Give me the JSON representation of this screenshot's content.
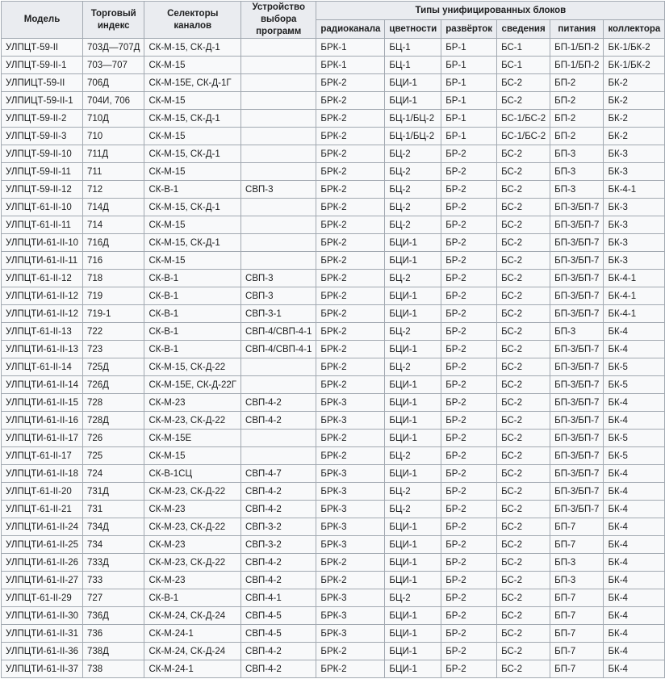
{
  "header": {
    "model": "Модель",
    "index": "Торговый индекс",
    "selectors": "Селекторы каналов",
    "program_device": "Устройство выбора программ",
    "blocks_group": "Типы унифицированных блоков",
    "blocks": [
      "радиоканала",
      "цветности",
      "развёрток",
      "сведения",
      "питания",
      "коллектора"
    ]
  },
  "rows": [
    [
      "УЛПЦТ-59-II",
      "703Д—707Д",
      "СК-М-15, СК-Д-1",
      "",
      "БРК-1",
      "БЦ-1",
      "БР-1",
      "БС-1",
      "БП-1/БП-2",
      "БК-1/БК-2"
    ],
    [
      "УЛПЦТ-59-II-1",
      "703—707",
      "СК-М-15",
      "",
      "БРК-1",
      "БЦ-1",
      "БР-1",
      "БС-1",
      "БП-1/БП-2",
      "БК-1/БК-2"
    ],
    [
      "УЛПИЦТ-59-II",
      "706Д",
      "СК-М-15Е, СК-Д-1Г",
      "",
      "БРК-2",
      "БЦИ-1",
      "БР-1",
      "БС-2",
      "БП-2",
      "БК-2"
    ],
    [
      "УЛПИЦТ-59-II-1",
      "704И, 706",
      "СК-М-15",
      "",
      "БРК-2",
      "БЦИ-1",
      "БР-1",
      "БС-2",
      "БП-2",
      "БК-2"
    ],
    [
      "УЛПЦТ-59-II-2",
      "710Д",
      "СК-М-15, СК-Д-1",
      "",
      "БРК-2",
      "БЦ-1/БЦ-2",
      "БР-1",
      "БС-1/БС-2",
      "БП-2",
      "БК-2"
    ],
    [
      "УЛПЦТ-59-II-3",
      "710",
      "СК-М-15",
      "",
      "БРК-2",
      "БЦ-1/БЦ-2",
      "БР-1",
      "БС-1/БС-2",
      "БП-2",
      "БК-2"
    ],
    [
      "УЛПЦТ-59-II-10",
      "711Д",
      "СК-М-15, СК-Д-1",
      "",
      "БРК-2",
      "БЦ-2",
      "БР-2",
      "БС-2",
      "БП-3",
      "БК-3"
    ],
    [
      "УЛПЦТ-59-II-11",
      "711",
      "СК-М-15",
      "",
      "БРК-2",
      "БЦ-2",
      "БР-2",
      "БС-2",
      "БП-3",
      "БК-3"
    ],
    [
      "УЛПЦТ-59-II-12",
      "712",
      "СК-В-1",
      "СВП-3",
      "БРК-2",
      "БЦ-2",
      "БР-2",
      "БС-2",
      "БП-3",
      "БК-4-1"
    ],
    [
      "УЛПЦТ-61-II-10",
      "714Д",
      "СК-М-15, СК-Д-1",
      "",
      "БРК-2",
      "БЦ-2",
      "БР-2",
      "БС-2",
      "БП-3/БП-7",
      "БК-3"
    ],
    [
      "УЛПЦТ-61-II-11",
      "714",
      "СК-М-15",
      "",
      "БРК-2",
      "БЦ-2",
      "БР-2",
      "БС-2",
      "БП-3/БП-7",
      "БК-3"
    ],
    [
      "УЛПЦТИ-61-II-10",
      "716Д",
      "СК-М-15, СК-Д-1",
      "",
      "БРК-2",
      "БЦИ-1",
      "БР-2",
      "БС-2",
      "БП-3/БП-7",
      "БК-3"
    ],
    [
      "УЛПЦТИ-61-II-11",
      "716",
      "СК-М-15",
      "",
      "БРК-2",
      "БЦИ-1",
      "БР-2",
      "БС-2",
      "БП-3/БП-7",
      "БК-3"
    ],
    [
      "УЛПЦТ-61-II-12",
      "718",
      "СК-В-1",
      "СВП-3",
      "БРК-2",
      "БЦ-2",
      "БР-2",
      "БС-2",
      "БП-3/БП-7",
      "БК-4-1"
    ],
    [
      "УЛПЦТИ-61-II-12",
      "719",
      "СК-В-1",
      "СВП-3",
      "БРК-2",
      "БЦИ-1",
      "БР-2",
      "БС-2",
      "БП-3/БП-7",
      "БК-4-1"
    ],
    [
      "УЛПЦТИ-61-II-12",
      "719-1",
      "СК-В-1",
      "СВП-3-1",
      "БРК-2",
      "БЦИ-1",
      "БР-2",
      "БС-2",
      "БП-3/БП-7",
      "БК-4-1"
    ],
    [
      "УЛПЦТ-61-II-13",
      "722",
      "СК-В-1",
      "СВП-4/СВП-4-1",
      "БРК-2",
      "БЦ-2",
      "БР-2",
      "БС-2",
      "БП-3",
      "БК-4"
    ],
    [
      "УЛПЦТИ-61-II-13",
      "723",
      "СК-В-1",
      "СВП-4/СВП-4-1",
      "БРК-2",
      "БЦИ-1",
      "БР-2",
      "БС-2",
      "БП-3/БП-7",
      "БК-4"
    ],
    [
      "УЛПЦТ-61-II-14",
      "725Д",
      "СК-М-15, СК-Д-22",
      "",
      "БРК-2",
      "БЦ-2",
      "БР-2",
      "БС-2",
      "БП-3/БП-7",
      "БК-5"
    ],
    [
      "УЛПЦТИ-61-II-14",
      "726Д",
      "СК-М-15Е, СК-Д-22Г",
      "",
      "БРК-2",
      "БЦИ-1",
      "БР-2",
      "БС-2",
      "БП-3/БП-7",
      "БК-5"
    ],
    [
      "УЛПЦТИ-61-II-15",
      "728",
      "СК-М-23",
      "СВП-4-2",
      "БРК-3",
      "БЦИ-1",
      "БР-2",
      "БС-2",
      "БП-3/БП-7",
      "БК-4"
    ],
    [
      "УЛПЦТИ-61-II-16",
      "728Д",
      "СК-М-23, СК-Д-22",
      "СВП-4-2",
      "БРК-3",
      "БЦИ-1",
      "БР-2",
      "БС-2",
      "БП-3/БП-7",
      "БК-4"
    ],
    [
      "УЛПЦТИ-61-II-17",
      "726",
      "СК-М-15Е",
      "",
      "БРК-2",
      "БЦИ-1",
      "БР-2",
      "БС-2",
      "БП-3/БП-7",
      "БК-5"
    ],
    [
      "УЛПЦТ-61-II-17",
      "725",
      "СК-М-15",
      "",
      "БРК-2",
      "БЦ-2",
      "БР-2",
      "БС-2",
      "БП-3/БП-7",
      "БК-5"
    ],
    [
      "УЛПЦТИ-61-II-18",
      "724",
      "СК-В-1СЦ",
      "СВП-4-7",
      "БРК-3",
      "БЦИ-1",
      "БР-2",
      "БС-2",
      "БП-3/БП-7",
      "БК-4"
    ],
    [
      "УЛПЦТ-61-II-20",
      "731Д",
      "СК-М-23, СК-Д-22",
      "СВП-4-2",
      "БРК-3",
      "БЦ-2",
      "БР-2",
      "БС-2",
      "БП-3/БП-7",
      "БК-4"
    ],
    [
      "УЛПЦТ-61-II-21",
      "731",
      "СК-М-23",
      "СВП-4-2",
      "БРК-3",
      "БЦ-2",
      "БР-2",
      "БС-2",
      "БП-3/БП-7",
      "БК-4"
    ],
    [
      "УЛПЦТИ-61-II-24",
      "734Д",
      "СК-М-23, СК-Д-22",
      "СВП-3-2",
      "БРК-3",
      "БЦИ-1",
      "БР-2",
      "БС-2",
      "БП-7",
      "БК-4"
    ],
    [
      "УЛПЦТИ-61-II-25",
      "734",
      "СК-М-23",
      "СВП-3-2",
      "БРК-3",
      "БЦИ-1",
      "БР-2",
      "БС-2",
      "БП-7",
      "БК-4"
    ],
    [
      "УЛПЦТИ-61-II-26",
      "733Д",
      "СК-М-23, СК-Д-22",
      "СВП-4-2",
      "БРК-2",
      "БЦИ-1",
      "БР-2",
      "БС-2",
      "БП-3",
      "БК-4"
    ],
    [
      "УЛПЦТИ-61-II-27",
      "733",
      "СК-М-23",
      "СВП-4-2",
      "БРК-2",
      "БЦИ-1",
      "БР-2",
      "БС-2",
      "БП-3",
      "БК-4"
    ],
    [
      "УЛПЦТ-61-II-29",
      "727",
      "СК-В-1",
      "СВП-4-1",
      "БРК-3",
      "БЦ-2",
      "БР-2",
      "БС-2",
      "БП-7",
      "БК-4"
    ],
    [
      "УЛПЦТИ-61-II-30",
      "736Д",
      "СК-М-24, СК-Д-24",
      "СВП-4-5",
      "БРК-3",
      "БЦИ-1",
      "БР-2",
      "БС-2",
      "БП-7",
      "БК-4"
    ],
    [
      "УЛПЦТИ-61-II-31",
      "736",
      "СК-М-24-1",
      "СВП-4-5",
      "БРК-3",
      "БЦИ-1",
      "БР-2",
      "БС-2",
      "БП-7",
      "БК-4"
    ],
    [
      "УЛПЦТИ-61-II-36",
      "738Д",
      "СК-М-24, СК-Д-24",
      "СВП-4-2",
      "БРК-2",
      "БЦИ-1",
      "БР-2",
      "БС-2",
      "БП-7",
      "БК-4"
    ],
    [
      "УЛПЦТИ-61-II-37",
      "738",
      "СК-М-24-1",
      "СВП-4-2",
      "БРК-2",
      "БЦИ-1",
      "БР-2",
      "БС-2",
      "БП-7",
      "БК-4"
    ]
  ]
}
